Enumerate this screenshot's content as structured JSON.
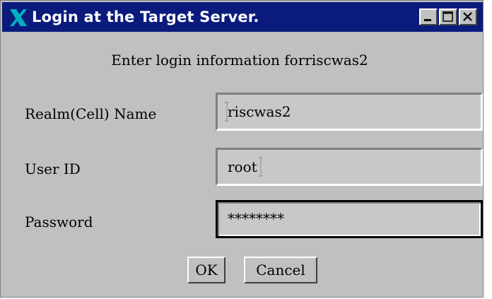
{
  "window": {
    "title": "Login at the Target Server.",
    "icon": "x-window-icon",
    "controls": [
      "minimize-icon",
      "maximize-icon",
      "close-icon"
    ]
  },
  "dialog": {
    "prompt": "Enter login information forriscwas2",
    "fields": {
      "realm": {
        "label": "Realm(Cell) Name",
        "value": "riscwas2"
      },
      "user": {
        "label": "User ID",
        "value": "root"
      },
      "password": {
        "label": "Password",
        "value": "********"
      }
    },
    "buttons": {
      "ok": "OK",
      "cancel": "Cancel"
    }
  },
  "colors": {
    "titlebar": "#0a1b7c",
    "window_bg": "#c0c0c0",
    "icon_accent": "#00b0c0"
  }
}
